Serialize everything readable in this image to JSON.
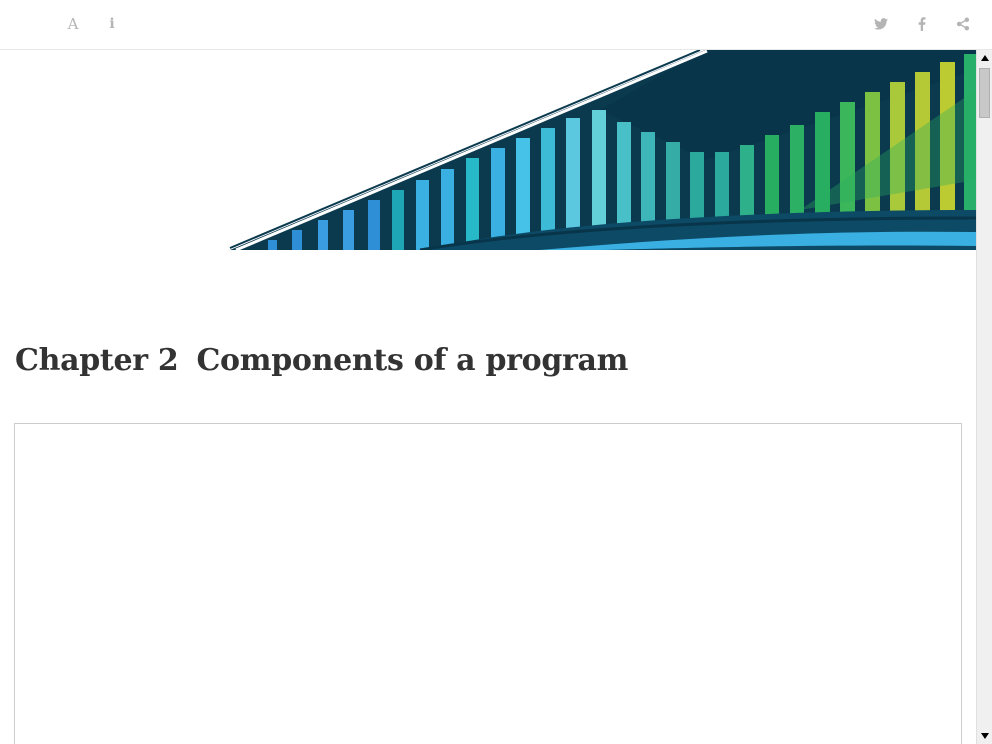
{
  "toolbar": {
    "left_icons": [
      "font-settings-icon",
      "info-icon"
    ],
    "right_icons": [
      "twitter-icon",
      "facebook-icon",
      "share-icon"
    ],
    "font_glyph": "A",
    "info_glyph": "i",
    "icon_color": "#b4b4b4"
  },
  "banner": {
    "image": "bridge-illustration",
    "colors": [
      "#0b3a4f",
      "#3ab0e2",
      "#1aa7a7",
      "#27ae60",
      "#b5c835"
    ]
  },
  "chapter": {
    "number": "Chapter 2",
    "title": "Components of a program"
  },
  "embed": {
    "content": ""
  },
  "scrollbar": {
    "up_icon": "arrow-up-icon",
    "down_icon": "arrow-down-icon"
  }
}
